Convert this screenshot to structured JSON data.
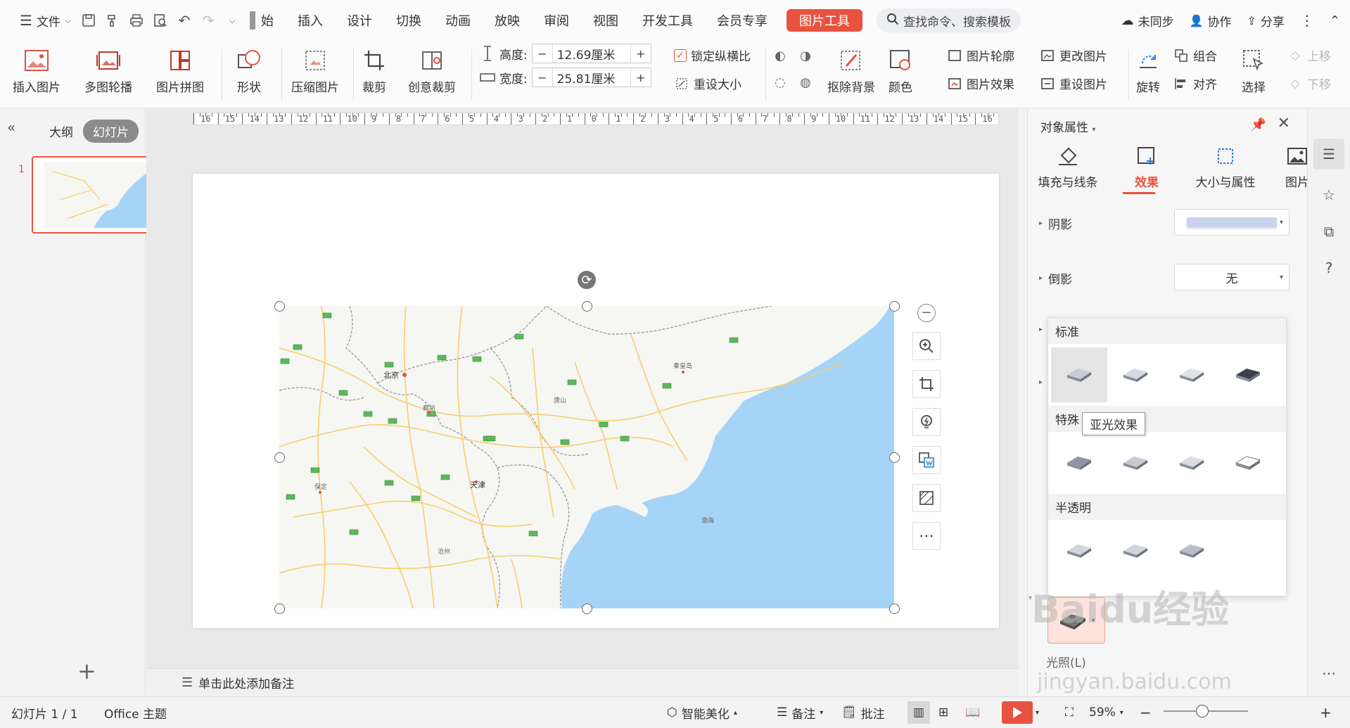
{
  "menubar": {
    "file_label": "文件",
    "tabs": [
      "始",
      "插入",
      "设计",
      "切换",
      "动画",
      "放映",
      "审阅",
      "视图",
      "开发工具",
      "会员专享"
    ],
    "active_tool_tab": "图片工具",
    "search_placeholder": "查找命令、搜索模板",
    "sync_label": "未同步",
    "collab_label": "协作",
    "share_label": "分享"
  },
  "ribbon": {
    "insert_picture": "插入图片",
    "multi_carousel": "多图轮播",
    "picture_collage": "图片拼图",
    "shape": "形状",
    "compress": "压缩图片",
    "crop": "裁剪",
    "creative_crop": "创意裁剪",
    "height_label": "高度:",
    "height_value": "12.69厘米",
    "width_label": "宽度:",
    "width_value": "25.81厘米",
    "lock_ratio": "锁定纵横比",
    "reset_size": "重设大小",
    "remove_bg": "抠除背景",
    "color": "颜色",
    "picture_outline": "图片轮廓",
    "picture_effect": "图片效果",
    "change_picture": "更改图片",
    "reset_picture": "重设图片",
    "rotate": "旋转",
    "group": "组合",
    "align": "对齐",
    "select": "选择",
    "move_up": "上移",
    "move_down": "下移",
    "minus": "−",
    "plus": "+"
  },
  "leftpanel": {
    "outline_tab": "大纲",
    "slides_tab": "幻灯片",
    "slide_number": "1"
  },
  "ruler": {
    "labels": [
      "16",
      "15",
      "14",
      "13",
      "12",
      "11",
      "10",
      "9",
      "8",
      "7",
      "6",
      "5",
      "4",
      "3",
      "2",
      "1",
      "0",
      "1",
      "2",
      "3",
      "4",
      "5",
      "6",
      "7",
      "8",
      "9",
      "10",
      "11",
      "12",
      "13",
      "14",
      "15",
      "16"
    ]
  },
  "map": {
    "beijing": "北京",
    "tianjin": "天津",
    "langfang": "廊坊",
    "tangshan": "唐山",
    "qinhuangdao": "秦皇岛",
    "baoding": "保定",
    "bohai": "渤海",
    "cangzhou": "沧州",
    "sea_color": "#a6d4f7",
    "land_color": "#f6f6f3",
    "road_color": "#f5cf6e",
    "border_color": "#9a9a9a"
  },
  "notes": {
    "placeholder": "单击此处添加备注"
  },
  "rightpanel": {
    "title": "对象属性",
    "tabs": [
      "填充与线条",
      "效果",
      "大小与属性",
      "图片"
    ],
    "shadow_label": "阴影",
    "reflection_label": "倒影",
    "reflection_value": "无",
    "popover": {
      "standard_header": "标准",
      "special_header": "特殊",
      "translucent_header": "半透明",
      "tooltip": "亚光效果"
    },
    "lighting_label": "光照(L)"
  },
  "statusbar": {
    "slide_info": "幻灯片 1 / 1",
    "theme": "Office 主题",
    "smart_beautify": "智能美化",
    "notes": "备注",
    "comments": "批注",
    "zoom": "59%",
    "minus": "−",
    "plus": "+"
  },
  "watermark": {
    "brand": "Baidu经验",
    "url": "jingyan.baidu.com"
  },
  "accent_color": "#e8533f"
}
